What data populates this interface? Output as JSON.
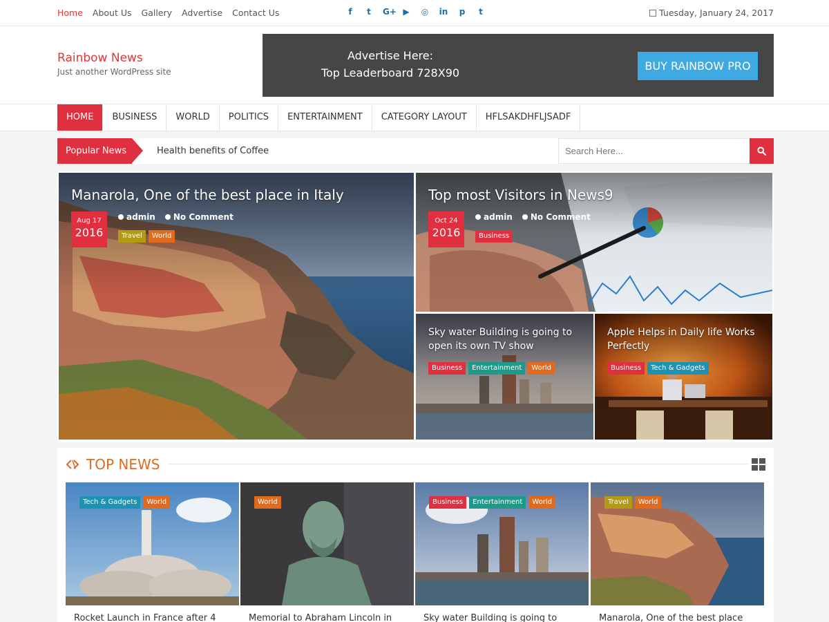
{
  "topbar": {
    "nav": [
      "Home",
      "About Us",
      "Gallery",
      "Advertise",
      "Contact Us"
    ],
    "social": [
      {
        "icon": "facebook-icon",
        "glyph": "f"
      },
      {
        "icon": "twitter-icon",
        "glyph": "t"
      },
      {
        "icon": "google-plus-icon",
        "glyph": "G+"
      },
      {
        "icon": "youtube-icon",
        "glyph": "▶"
      },
      {
        "icon": "instagram-icon",
        "glyph": "◎"
      },
      {
        "icon": "linkedin-icon",
        "glyph": "in"
      },
      {
        "icon": "pinterest-icon",
        "glyph": "p"
      },
      {
        "icon": "tumblr-icon",
        "glyph": "t"
      }
    ],
    "date": "Tuesday, January 24, 2017"
  },
  "header": {
    "site_title": "Rainbow News",
    "tagline": "Just another WordPress site",
    "ad_line1": "Advertise Here:",
    "ad_line2": "Top Leaderboard 728X90",
    "buy_button": "BUY RAINBOW PRO"
  },
  "main_nav": [
    "HOME",
    "BUSINESS",
    "WORLD",
    "POLITICS",
    "ENTERTAINMENT",
    "CATEGORY LAYOUT",
    "HFLSAKDHFLJSADF"
  ],
  "ticker": {
    "label": "Popular News",
    "text": "Health benefits of Coffee",
    "search_placeholder": "Search Here..."
  },
  "featured": [
    {
      "title": "Manarola, One of the best place in Italy",
      "date_md": "Aug 17",
      "date_year": "2016",
      "author": "admin",
      "comments": "No Comment",
      "tags": [
        "Travel",
        "World"
      ]
    },
    {
      "title": "Top most Visitors in News9",
      "date_md": "Oct 24",
      "date_year": "2016",
      "author": "admin",
      "comments": "No Comment",
      "tags": [
        "Business"
      ]
    },
    {
      "title_line1": "Sky water Building is going to",
      "title_line2": "open its own TV show",
      "tags": [
        "Business",
        "Entertainment",
        "World"
      ]
    },
    {
      "title_line1": "Apple Helps in Daily life Works",
      "title_line2": "Perfectly",
      "tags": [
        "Business",
        "Tech & Gadgets"
      ]
    }
  ],
  "top_news": {
    "title": "TOP NEWS",
    "items": [
      {
        "tags": [
          "Tech & Gadgets",
          "World"
        ],
        "caption": "Rocket Launch in France after 4"
      },
      {
        "tags": [
          "World"
        ],
        "caption": "Memorial to Abraham Lincoln in"
      },
      {
        "tags": [
          "Business",
          "Entertainment",
          "World"
        ],
        "caption": "Sky water Building is going to"
      },
      {
        "tags": [
          "Travel",
          "World"
        ],
        "caption": "Manarola, One of the best place"
      }
    ]
  },
  "colors": {
    "accent_red": "#e0303f",
    "accent_orange": "#e06a1e",
    "accent_blue": "#3fa9e2"
  }
}
